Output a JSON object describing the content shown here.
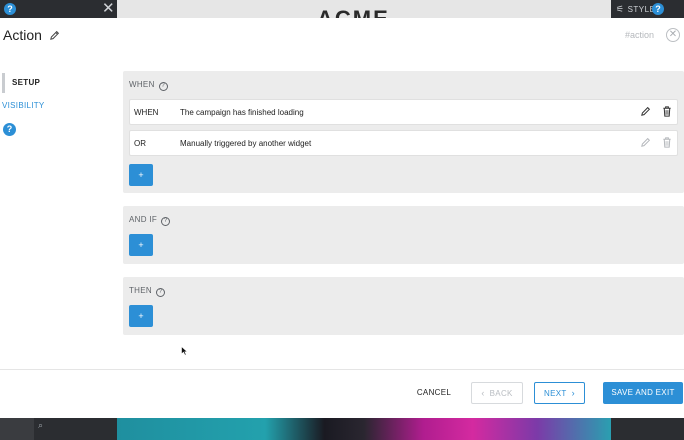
{
  "app": {
    "top_logo": "ACME",
    "style_label": "STYLE",
    "help_glyph": "?",
    "close_glyph": "✕"
  },
  "modal": {
    "title": "Action",
    "hash_label": "#action",
    "close_glyph": "✕"
  },
  "nav": {
    "items": [
      {
        "label": "SETUP",
        "active": true
      },
      {
        "label": "VISIBILITY",
        "active": false
      }
    ],
    "help_glyph": "?"
  },
  "sections": {
    "when": {
      "heading": "WHEN",
      "conditions": [
        {
          "keyword": "WHEN",
          "description": "The campaign has finished loading"
        },
        {
          "keyword": "OR",
          "description": "Manually triggered by another widget"
        }
      ],
      "add_label": "+"
    },
    "and_if": {
      "heading": "AND IF",
      "add_label": "+"
    },
    "then": {
      "heading": "THEN",
      "add_label": "+"
    },
    "help_glyph": "?"
  },
  "footer": {
    "cancel": "CANCEL",
    "back": "BACK",
    "next": "NEXT",
    "save": "SAVE AND EXIT",
    "back_chevron": "‹",
    "next_chevron": "›"
  },
  "colors": {
    "accent": "#2c8fd6",
    "panel_bg": "#ececec",
    "dark_bar": "#2b2d31"
  }
}
